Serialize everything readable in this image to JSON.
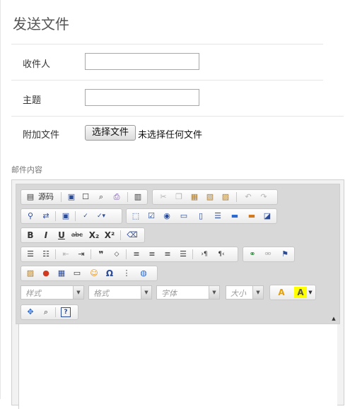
{
  "page": {
    "title": "发送文件"
  },
  "form": {
    "recipient_label": "收件人",
    "recipient_value": "",
    "subject_label": "主题",
    "subject_value": "",
    "attachment_label": "附加文件",
    "file_button": "选择文件",
    "no_file_text": "未选择任何文件",
    "content_label": "邮件内容"
  },
  "editor": {
    "source_label": "源码",
    "style_placeholder": "样式",
    "format_placeholder": "格式",
    "font_placeholder": "字体",
    "size_placeholder": "大小",
    "toolbar_text": {
      "bold": "B",
      "italic": "I",
      "underline": "U",
      "strike": "abc",
      "subscript": "X₂",
      "superscript": "X²",
      "help": "?",
      "text_color": "A",
      "bg_color": "A"
    },
    "colors": {
      "text_color": "#e8a000",
      "bg_color": "#ffff00"
    }
  }
}
